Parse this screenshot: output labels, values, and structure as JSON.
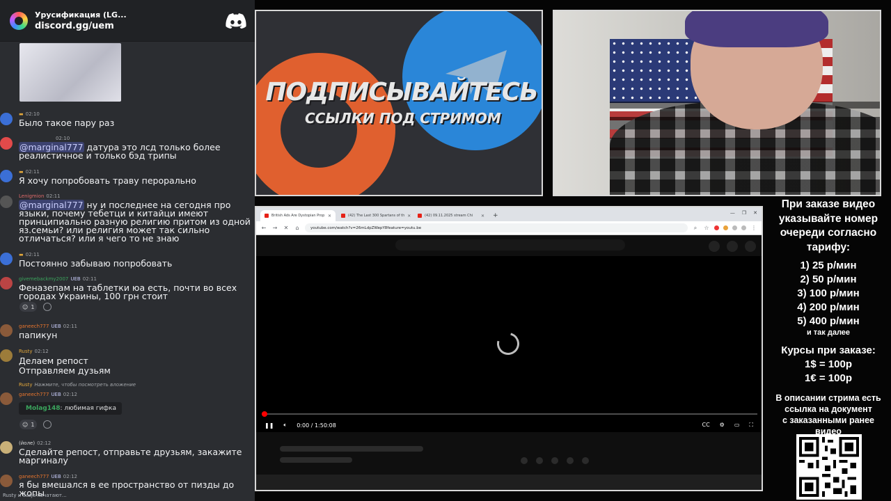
{
  "discord": {
    "server_name": "Урусификация (LG...",
    "invite": "discord.gg/uem",
    "typing": "Rusty и Sasja печатают...",
    "messages": [
      {
        "time": "02:10",
        "text": "Было такое пару раз"
      },
      {
        "time": "02:10",
        "mention": "@marginal777",
        "text": " датура это лсд только более реалистичное и только бэд трипы"
      },
      {
        "time": "02:11",
        "text": "Я хочу попробовать траву перорально"
      },
      {
        "name": "Lenigmion",
        "time": "02:11",
        "mention": "@marginal777",
        "text": " ну и последнее на сегодня про языки, почему тебетци и китайци имеют принципиально разную религию притом из одной яз.семьи? или религия может так сильно отличаться? или я чего то не знаю"
      },
      {
        "time": "02:11",
        "text": "Постоянно забываю попробовать"
      },
      {
        "name": "givemebackmy2007",
        "badge": "UEB",
        "time": "02:11",
        "text": "Феназепам на таблетки юа есть, почти во всех городах Украины, 100 грн стоит",
        "reaction_count": "1"
      },
      {
        "name": "ganeech777",
        "badge": "UEB",
        "time": "02:11",
        "text": "папикун"
      },
      {
        "name": "Rusty",
        "time": "02:12",
        "text": "Делаем репост\nОтправляем дузьям"
      },
      {
        "reply_name": "Rusty",
        "reply_text": "Нажмите, чтобы посмотреть вложение",
        "name": "ganeech777",
        "badge": "UEB",
        "time": "02:12",
        "embed_user": "Molag148",
        "embed_text": ": любимая гифка",
        "reaction_count": "1"
      },
      {
        "name": "(йоле)",
        "time": "02:12",
        "text": "Сделайте репост, отправьте друзьям, закажите маргиналу"
      },
      {
        "name": "ganeech777",
        "badge": "UEB",
        "time": "02:12",
        "text": "я бы вмешался в ее пространство от пизды до жопы"
      }
    ]
  },
  "promo": {
    "title": "ПОДПИСЫВАЙТЕСЬ",
    "subtitle": "ССЫЛКИ ПОД СТРИМОМ"
  },
  "browser": {
    "tabs": [
      {
        "label": "British Ads Are Dystopian Prop"
      },
      {
        "label": "(42) The Last 300 Spartans of th"
      },
      {
        "label": "(42) 09.11.2025 stream Chi"
      }
    ],
    "url": "youtube.com/watch?v=26mLdpZWepY8feature=youtu.be",
    "time": "0:00 / 1:50:08"
  },
  "info": {
    "heading": [
      "При заказе видео",
      "указывайте номер",
      "очереди согласно",
      "тарифу:"
    ],
    "tariffs": [
      "1) 25 р/мин",
      "2) 50 р/мин",
      "3) 100 р/мин",
      "4) 200 р/мин",
      "5) 400 р/мин"
    ],
    "etc": "и так далее",
    "courses_title": "Курсы при заказе:",
    "courses": [
      "1$ = 100р",
      "1€ = 100р"
    ],
    "description": [
      "В описании стрима есть",
      "ссылка на документ",
      "с заказанными ранее",
      "видео"
    ]
  },
  "colors": {
    "discord_bg": "#2b2d31",
    "mention_bg": "#3c4270",
    "yt_red": "#ff0000",
    "name_gold": "#e3a83b"
  }
}
